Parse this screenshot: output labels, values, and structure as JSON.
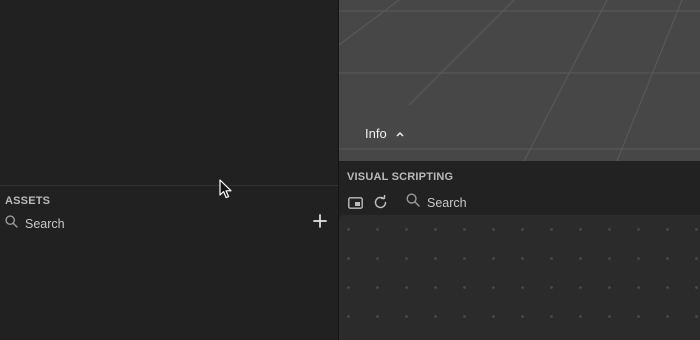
{
  "assets": {
    "title": "ASSETS",
    "search_placeholder": "Search",
    "icons": {
      "search": "search-icon",
      "add": "plus-icon"
    }
  },
  "viewport": {
    "info_label": "Info",
    "icons": {
      "info_toggle": "chevron-up-icon"
    }
  },
  "visual_scripting": {
    "title": "VISUAL SCRIPTING",
    "search_placeholder": "Search",
    "icons": {
      "frame": "picture-in-picture-icon",
      "refresh": "refresh-icon",
      "search": "search-icon"
    }
  },
  "colors": {
    "panel_bg": "#212121",
    "viewport_bg": "#474747",
    "grid_line": "#5a5a5a",
    "canvas_bg": "#2b2b2b",
    "canvas_dot": "#4a4a4a",
    "text": "#d6d6d6",
    "title_text": "#b9b9b9"
  }
}
